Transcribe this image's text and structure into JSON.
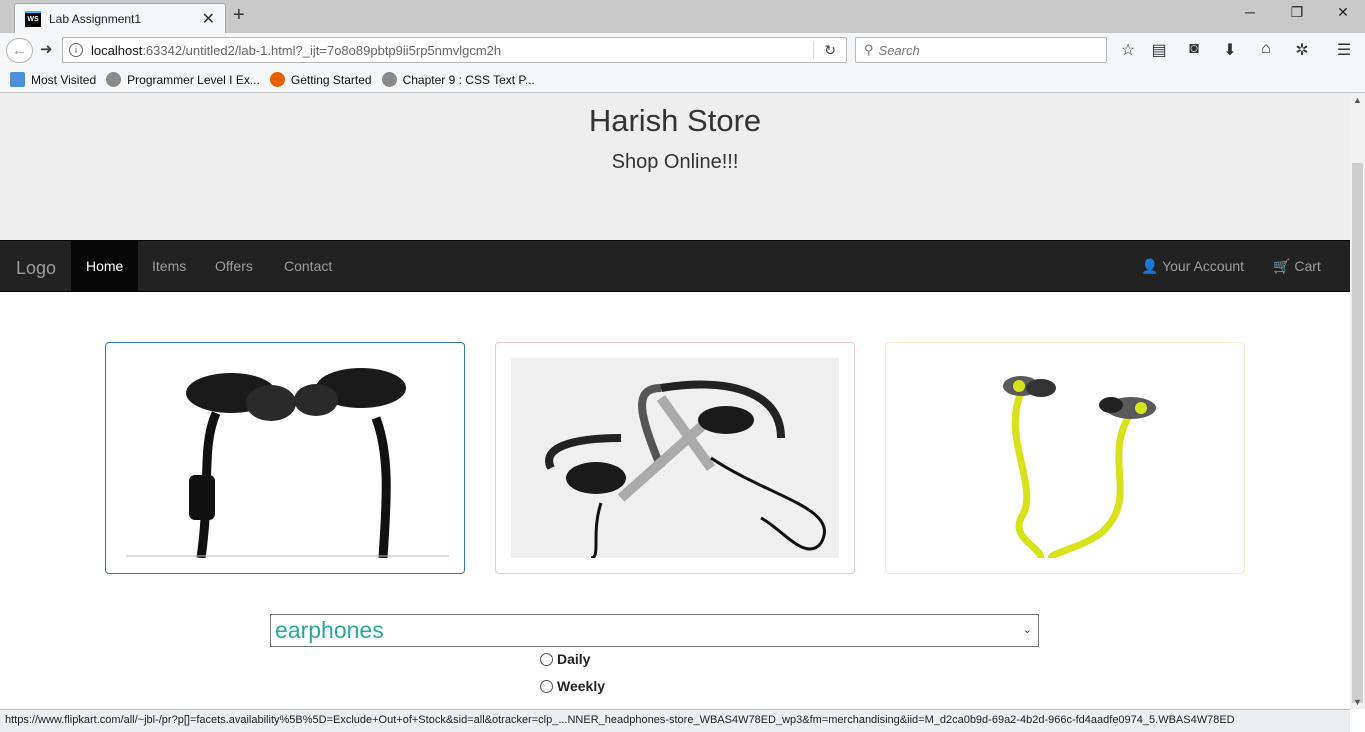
{
  "browser": {
    "tab_title": "Lab Assignment1",
    "tab_icon_text": "WS",
    "url_host": "localhost",
    "url_path": ":63342/untitled2/lab-1.html?_ijt=7o8o89pbtp9ii5rp5nmvlgcm2h",
    "search_placeholder": "Search",
    "bookmarks": [
      "Most Visited",
      "Programmer Level I Ex...",
      "Getting Started",
      "Chapter 9 : CSS Text P..."
    ]
  },
  "page": {
    "store_title": "Harish Store",
    "tagline": "Shop Online!!!",
    "nav": {
      "brand": "Logo",
      "links": [
        "Home",
        "Items",
        "Offers",
        "Contact"
      ],
      "active": "Home",
      "account": "Your Account",
      "cart": "Cart"
    },
    "products": [
      {
        "name": "black-earphones",
        "border_color": "#337ab7"
      },
      {
        "name": "silver-black-earhook-headphones",
        "border_color": "#ebccd1"
      },
      {
        "name": "yellow-earphones",
        "border_color": "#faebcc"
      }
    ],
    "category_select": {
      "value": "earphones"
    },
    "frequency_options": [
      "Daily",
      "Weekly"
    ]
  },
  "status_url": "https://www.flipkart.com/all/~jbl-/pr?p[]=facets.availability%5B%5D=Exclude+Out+of+Stock&sid=all&otracker=clp_...NNER_headphones-store_WBAS4W78ED_wp3&fm=merchandising&iid=M_d2ca0b9d-69a2-4b2d-966c-fd4aadfe0974_5.WBAS4W78ED"
}
